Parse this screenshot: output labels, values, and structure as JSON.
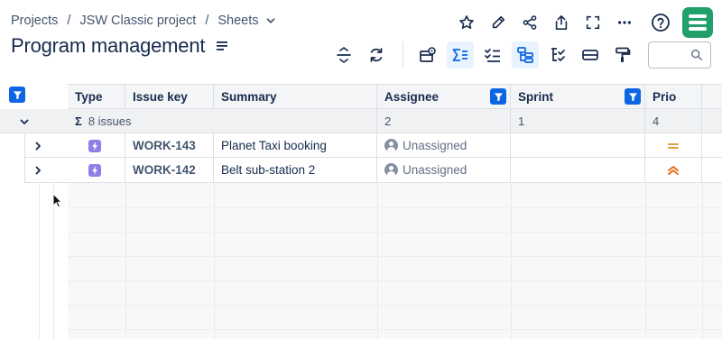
{
  "breadcrumb": {
    "items": [
      "Projects",
      "JSW Classic project",
      "Sheets"
    ],
    "separator": "/"
  },
  "page": {
    "title": "Program management"
  },
  "top_actions": [
    "star-icon",
    "edit-icon",
    "share-icon",
    "export-icon",
    "fullscreen-icon",
    "more-icon",
    "help-icon",
    "app-logo"
  ],
  "toolbar": {
    "buttons": [
      "collapse-expand",
      "refresh",
      "view-settings",
      "sum-toggle",
      "checklist",
      "hierarchy",
      "tree-structure",
      "row-height",
      "format-painter"
    ],
    "active": [
      "sum-toggle",
      "hierarchy"
    ]
  },
  "search": {
    "placeholder": "",
    "value": ""
  },
  "grid": {
    "columns": [
      {
        "key": "type",
        "label": "Type"
      },
      {
        "key": "issue_key",
        "label": "Issue key"
      },
      {
        "key": "summary",
        "label": "Summary"
      },
      {
        "key": "assignee",
        "label": "Assignee",
        "filtered": true
      },
      {
        "key": "sprint",
        "label": "Sprint",
        "filtered": true
      },
      {
        "key": "priority",
        "label": "Prio"
      }
    ],
    "summary_row": {
      "count_text": "8 issues",
      "assignee": "2",
      "sprint": "1",
      "priority": "4"
    },
    "rows": [
      {
        "type_icon": "epic-icon",
        "issue_key": "WORK-143",
        "summary": "Planet Taxi booking",
        "assignee": "Unassigned",
        "sprint": "",
        "priority": "medium-priority-icon"
      },
      {
        "type_icon": "epic-icon",
        "issue_key": "WORK-142",
        "summary": "Belt sub-station 2",
        "assignee": "Unassigned",
        "sprint": "",
        "priority": "high-priority-icon"
      }
    ]
  },
  "colors": {
    "accent": "#0c66e4",
    "accent_bg": "#e9f2ff",
    "epic": "#8f7ee7",
    "priority_medium": "#e2a03f",
    "priority_high": "#e56910",
    "logo": "#22a06b"
  }
}
